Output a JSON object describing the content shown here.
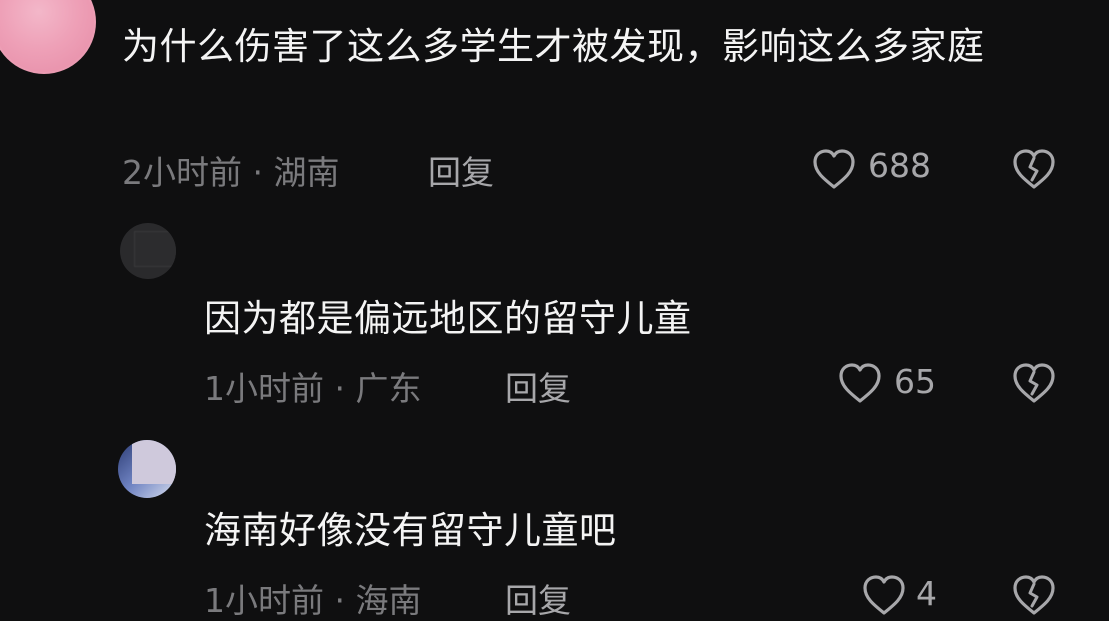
{
  "comments": [
    {
      "text": "为什么伤害了这么多学生才被发现，影响这么多家庭",
      "time": "2小时前",
      "location": "湖南",
      "reply_label": "回复",
      "likes": "688"
    },
    {
      "text": "因为都是偏远地区的留守儿童",
      "time": "1小时前",
      "location": "广东",
      "reply_label": "回复",
      "likes": "65"
    },
    {
      "text": "海南好像没有留守儿童吧",
      "time": "1小时前",
      "location": "海南",
      "reply_label": "回复",
      "likes": "4"
    }
  ],
  "meta_separator": " · ",
  "icons": {
    "like": "heart-outline-icon",
    "dislike": "broken-heart-icon"
  },
  "colors": {
    "background": "#0f0f10",
    "text": "#f4f4f4",
    "meta": "#7a7a7d",
    "action": "#a7a7aa"
  }
}
